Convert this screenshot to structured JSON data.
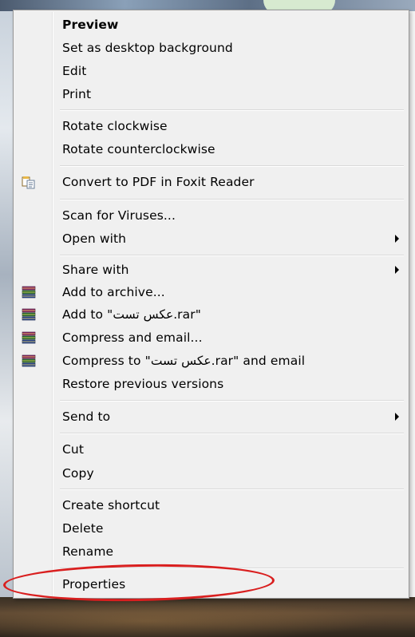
{
  "menu": {
    "preview": "Preview",
    "set_background": "Set as desktop background",
    "edit": "Edit",
    "print": "Print",
    "rotate_cw": "Rotate clockwise",
    "rotate_ccw": "Rotate counterclockwise",
    "convert_pdf": "Convert to PDF in Foxit Reader",
    "scan_viruses": "Scan for Viruses...",
    "open_with": "Open with",
    "share_with": "Share with",
    "add_archive": "Add to archive...",
    "add_to_rar": "Add to \"عکس تست.rar\"",
    "compress_email": "Compress and email...",
    "compress_rar_email": "Compress to \"عکس تست.rar\" and email",
    "restore_versions": "Restore previous versions",
    "send_to": "Send to",
    "cut": "Cut",
    "copy": "Copy",
    "create_shortcut": "Create shortcut",
    "delete": "Delete",
    "rename": "Rename",
    "properties": "Properties"
  },
  "icons": {
    "foxit": "foxit-convert-icon",
    "winrar": "winrar-books-icon"
  },
  "colors": {
    "menu_bg": "#f0f0f0",
    "annotation": "#d91f1f"
  }
}
